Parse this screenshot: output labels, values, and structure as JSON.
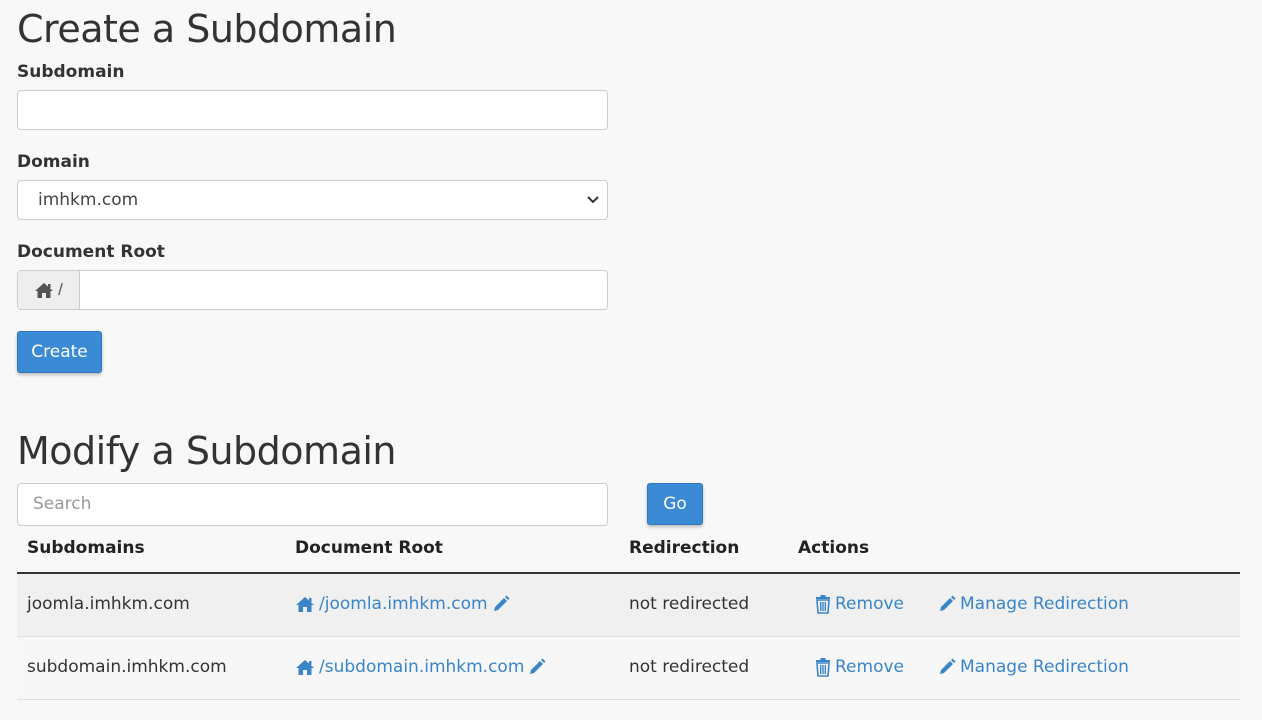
{
  "create": {
    "title": "Create a Subdomain",
    "subdomain_label": "Subdomain",
    "subdomain_value": "",
    "domain_label": "Domain",
    "domain_selected": "imhkm.com",
    "docroot_label": "Document Root",
    "docroot_prefix": "/",
    "docroot_value": "",
    "create_button": "Create"
  },
  "modify": {
    "title": "Modify a Subdomain",
    "search_placeholder": "Search",
    "go_button": "Go",
    "columns": [
      "Subdomains",
      "Document Root",
      "Redirection",
      "Actions"
    ],
    "rows": [
      {
        "subdomain": "joomla.imhkm.com",
        "docroot": "/joomla.imhkm.com",
        "redirection": "not redirected",
        "remove": "Remove",
        "manage": "Manage Redirection"
      },
      {
        "subdomain": "subdomain.imhkm.com",
        "docroot": "/subdomain.imhkm.com",
        "redirection": "not redirected",
        "remove": "Remove",
        "manage": "Manage Redirection"
      }
    ]
  },
  "colors": {
    "primary": "#3a8ad6",
    "link": "#3a85c8",
    "background": "#f8f8f8"
  },
  "icons": [
    "home-icon",
    "pencil-icon",
    "trash-icon",
    "chevron-down-icon"
  ]
}
